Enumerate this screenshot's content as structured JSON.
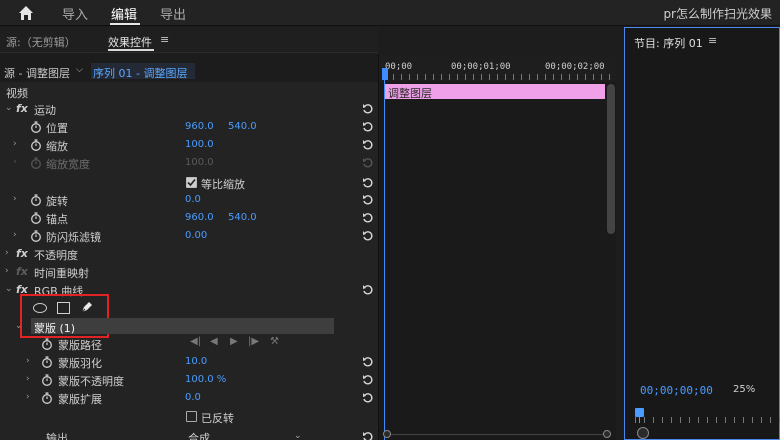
{
  "topbar": {
    "nav": [
      "导入",
      "编辑",
      "导出"
    ],
    "active": "编辑",
    "project_title": "pr怎么制作扫光效果",
    "home_icon": "home-icon"
  },
  "source_tab": "源:（无剪辑）",
  "effects_tab": "效果控件",
  "menu_glyph": "≡",
  "program": {
    "title": "节目: 序列 01",
    "timecode": "00;00;00;00",
    "zoom": "25%"
  },
  "clip": {
    "source": "源 - 调整图层",
    "sequence": "序列 01 - 调整图层"
  },
  "timeline": {
    "ticks": [
      "00;00",
      "00;00;01;00",
      "00;00;02;00"
    ],
    "clip_label": "调整图层"
  },
  "effects": {
    "section": "视频",
    "motion": {
      "name": "运动",
      "position": {
        "label": "位置",
        "x": "960.0",
        "y": "540.0"
      },
      "scale": {
        "label": "缩放",
        "value": "100.0"
      },
      "scale_width": {
        "label": "缩放宽度",
        "value": "100.0"
      },
      "uniform_scale": "等比缩放",
      "rotation": {
        "label": "旋转",
        "value": "0.0"
      },
      "anchor": {
        "label": "锚点",
        "x": "960.0",
        "y": "540.0"
      },
      "anti_flicker": {
        "label": "防闪烁滤镜",
        "value": "0.00"
      }
    },
    "opacity": "不透明度",
    "time_remap": "时间重映射",
    "rgb_curves": "RGB 曲线",
    "mask": {
      "name": "蒙版 (1)",
      "path": "蒙版路径",
      "feather": {
        "label": "蒙版羽化",
        "value": "10.0"
      },
      "opacity": {
        "label": "蒙版不透明度",
        "value": "100.0 %"
      },
      "expansion": {
        "label": "蒙版扩展",
        "value": "0.0"
      },
      "inverted": "已反转"
    },
    "output": {
      "label": "输出",
      "value": "合成"
    }
  }
}
